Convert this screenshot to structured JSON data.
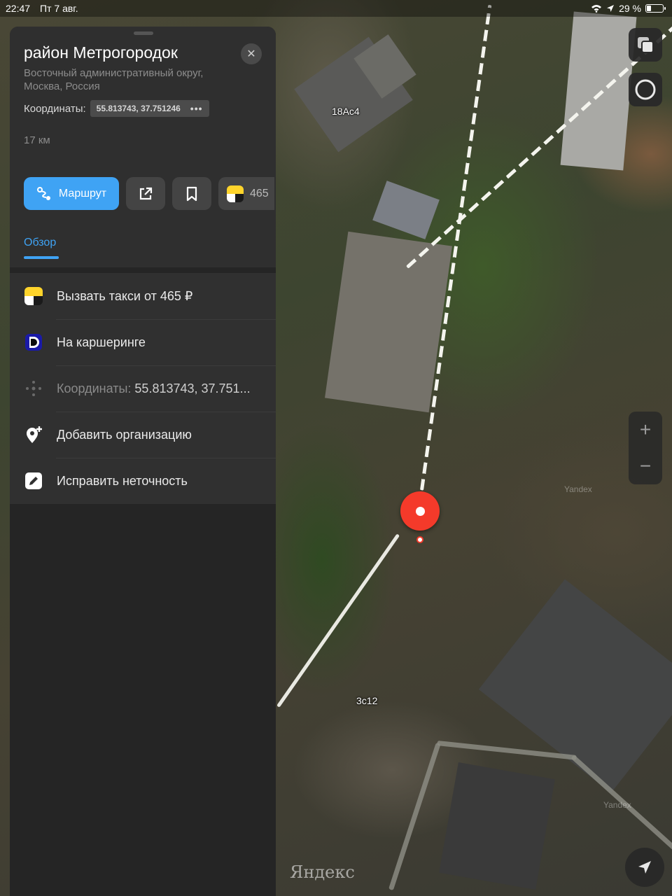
{
  "status_bar": {
    "time": "22:47",
    "date": "Пт 7 авг.",
    "battery": "29 %",
    "battery_level": 0.29
  },
  "place": {
    "title": "район Метрогородок",
    "subtitle": "Восточный административный округ, Москва, Россия",
    "coordinates_label": "Координаты:",
    "coordinates_value": "55.813743, 37.751246",
    "distance": "17 км"
  },
  "actions": {
    "route_label": "Маршрут",
    "taxi_price": "465"
  },
  "tabs": {
    "overview": "Обзор"
  },
  "list": {
    "taxi": "Вызвать такси от 465 ₽",
    "carsharing": "На каршеринге",
    "coords_label": "Координаты:",
    "coords_value": "55.813743, 37.751...",
    "add_org": "Добавить организацию",
    "fix": "Исправить неточность"
  },
  "map": {
    "label_top": "18Ас4",
    "label_bottom": "3с12",
    "watermark": "Yandex",
    "brand": "Яндекс"
  },
  "colors": {
    "accent": "#3fa3f4",
    "pin": "#f43a2a",
    "panel": "#252525"
  }
}
